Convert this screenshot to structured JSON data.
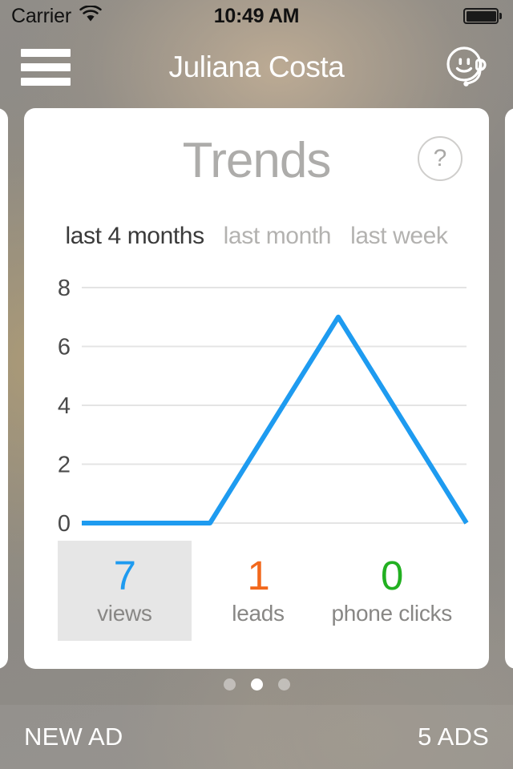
{
  "status_bar": {
    "carrier": "Carrier",
    "wifi_icon": "wifi-icon",
    "time": "10:49 AM",
    "battery_icon": "battery-full-icon"
  },
  "nav_bar": {
    "menu_icon": "hamburger-menu-icon",
    "title": "Juliana Costa",
    "support_icon": "smiley-headset-support-icon"
  },
  "card": {
    "title": "Trends",
    "help_label": "?",
    "tabs": [
      {
        "label": "last 4 months",
        "active": true
      },
      {
        "label": "last month",
        "active": false
      },
      {
        "label": "last week",
        "active": false
      }
    ],
    "stats": [
      {
        "value": "7",
        "label": "views",
        "color": "#1e9bf0",
        "selected": true
      },
      {
        "value": "1",
        "label": "leads",
        "color": "#f2681c",
        "selected": false
      },
      {
        "value": "0",
        "label": "phone clicks",
        "color": "#22b021",
        "selected": false
      }
    ]
  },
  "chart_data": {
    "type": "line",
    "title": "Trends",
    "series": [
      {
        "name": "views",
        "values": [
          0,
          0,
          7,
          0
        ],
        "color": "#1e9bf0"
      }
    ],
    "x": [
      1,
      2,
      3,
      4
    ],
    "categories": [
      "",
      "",
      "",
      ""
    ],
    "xlabel": "",
    "ylabel": "",
    "ylim": [
      0,
      8
    ],
    "yticks": [
      "0",
      "2",
      "4",
      "6",
      "8"
    ],
    "grid": true,
    "legend": false,
    "period": "last 4 months"
  },
  "pagination": {
    "dots": [
      {
        "active": false
      },
      {
        "active": true
      },
      {
        "active": false
      }
    ]
  },
  "bottom_bar": {
    "new_ad_label": "NEW AD",
    "ads_count_label": "5 ADS"
  }
}
